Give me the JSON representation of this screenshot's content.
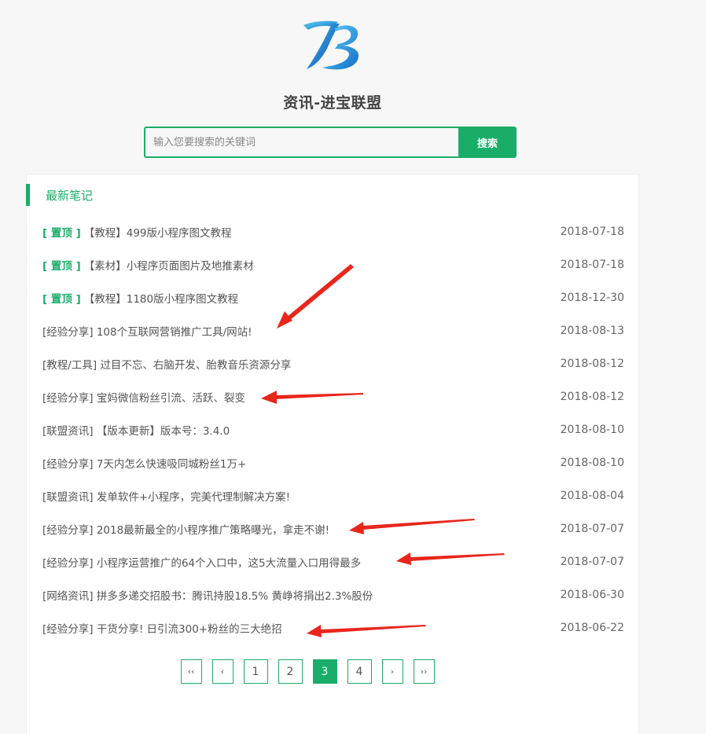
{
  "header": {
    "site_title": "资讯-进宝联盟"
  },
  "search": {
    "placeholder": "输入您要搜索的关键词",
    "button_label": "搜索"
  },
  "section": {
    "title": "最新笔记"
  },
  "notes": [
    {
      "pin": "[ 置顶 ]",
      "title": "【教程】499版小程序图文教程",
      "date": "2018-07-18"
    },
    {
      "pin": "[ 置顶 ]",
      "title": "【素材】小程序页面图片及地推素材",
      "date": "2018-07-18"
    },
    {
      "pin": "[ 置顶 ]",
      "title": "【教程】1180版小程序图文教程",
      "date": "2018-12-30"
    },
    {
      "pin": "",
      "title": "[经验分享] 108个互联网营销推广工具/网站!",
      "date": "2018-08-13"
    },
    {
      "pin": "",
      "title": "[教程/工具] 过目不忘、右脑开发、胎教音乐资源分享",
      "date": "2018-08-12"
    },
    {
      "pin": "",
      "title": "[经验分享] 宝妈微信粉丝引流、活跃、裂变",
      "date": "2018-08-12"
    },
    {
      "pin": "",
      "title": "[联盟资讯] 【版本更新】版本号：3.4.0",
      "date": "2018-08-10"
    },
    {
      "pin": "",
      "title": "[经验分享] 7天内怎么快速吸同城粉丝1万+",
      "date": "2018-08-10"
    },
    {
      "pin": "",
      "title": "[联盟资讯] 发单软件+小程序，完美代理制解决方案!",
      "date": "2018-08-04"
    },
    {
      "pin": "",
      "title": "[经验分享] 2018最新最全的小程序推广策略曝光，拿走不谢!",
      "date": "2018-07-07"
    },
    {
      "pin": "",
      "title": "[经验分享] 小程序运营推广的64个入口中，这5大流量入口用得最多",
      "date": "2018-07-07"
    },
    {
      "pin": "",
      "title": "[网络资讯] 拼多多递交招股书：腾讯持股18.5% 黄峥将捐出2.3%股份",
      "date": "2018-06-30"
    },
    {
      "pin": "",
      "title": "[经验分享] 干货分享! 日引流300+粉丝的三大绝招",
      "date": "2018-06-22"
    }
  ],
  "pagination": {
    "first": "‹‹",
    "prev": "‹",
    "pages": [
      "1",
      "2",
      "3",
      "4"
    ],
    "current": "3",
    "next": "›",
    "last": "››"
  },
  "colors": {
    "accent": "#1aad6a",
    "annotation_arrow": "#e8261c"
  }
}
